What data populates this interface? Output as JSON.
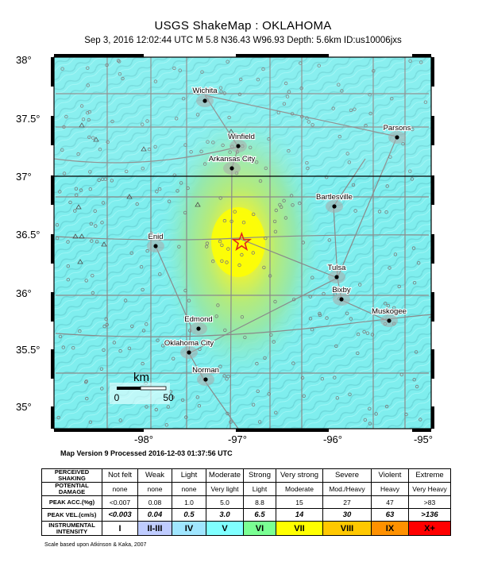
{
  "title": "USGS ShakeMap : OKLAHOMA",
  "subtitle": "Sep  3, 2016 12:02:44 UTC   M 5.8   N36.43 W96.93   Depth: 5.6km   ID:us10006jxs",
  "map": {
    "lat_labels": [
      "38°",
      "37.5°",
      "37°",
      "36.5°",
      "36°",
      "35.5°",
      "35°"
    ],
    "lon_labels": [
      "-98°",
      "-97°",
      "-96°",
      "-95°"
    ],
    "cities": [
      "Wichita",
      "Winfield",
      "Arkansas City",
      "Parsons",
      "Bartlesville",
      "Enid",
      "Tulsa",
      "Bixby",
      "Edmond",
      "Muskogee",
      "Oklahoma City",
      "Norman"
    ],
    "scale_bar": {
      "unit": "km",
      "start": "0",
      "end": "50"
    },
    "epicenter": {
      "lat": 36.43,
      "lon": -96.93
    },
    "colors": {
      "low": "#7ff0ee",
      "mid": "#9ce7a0",
      "high": "#ffff00",
      "epicenter": "#e0261d"
    }
  },
  "version_note": "Map Version 9 Processed 2016-12-03 01:37:56 UTC",
  "legend": {
    "row_labels": {
      "shaking": "PERCEIVED SHAKING",
      "damage": "POTENTIAL DAMAGE",
      "pga": "PEAK ACC.(%g)",
      "pgv": "PEAK VEL.(cm/s)",
      "intensity": "INSTRUMENTAL INTENSITY"
    },
    "shaking": [
      "Not felt",
      "Weak",
      "Light",
      "Moderate",
      "Strong",
      "Very strong",
      "Severe",
      "Violent",
      "Extreme"
    ],
    "damage": [
      "none",
      "none",
      "none",
      "Very light",
      "Light",
      "Moderate",
      "Mod./Heavy",
      "Heavy",
      "Very Heavy"
    ],
    "pga": [
      "<0.007",
      "0.08",
      "1.0",
      "5.0",
      "8.8",
      "15",
      "27",
      "47",
      ">83"
    ],
    "pgv": [
      "<0.003",
      "0.04",
      "0.5",
      "3.0",
      "6.5",
      "14",
      "30",
      "63",
      ">136"
    ],
    "intensity": [
      "I",
      "II-III",
      "IV",
      "V",
      "VI",
      "VII",
      "VIII",
      "IX",
      "X+"
    ],
    "intensity_colors": [
      "#ffffff",
      "#bfccff",
      "#a0e6ff",
      "#80ffff",
      "#7aff93",
      "#ffff00",
      "#ffc800",
      "#ff9100",
      "#ff0000"
    ],
    "scale_note": "Scale based upon Atkinson & Kaka, 2007"
  }
}
